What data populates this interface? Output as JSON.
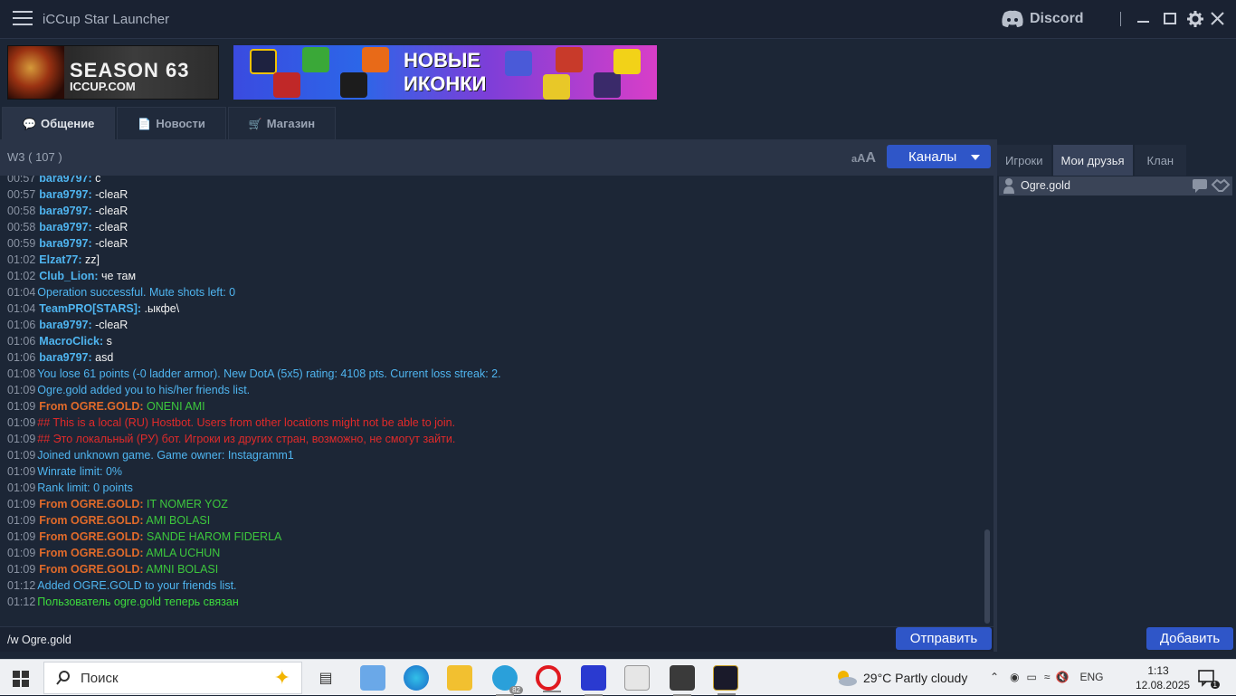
{
  "window": {
    "title": "iCCup Star Launcher",
    "discord_label": "Discord"
  },
  "banners": {
    "season_line1": "SEASON 63",
    "season_line2": "ICCUP.COM",
    "promo_line1": "НОВЫЕ",
    "promo_line2": "ИКОНКИ"
  },
  "tabs": [
    {
      "label": "Общение",
      "icon": "chat-icon",
      "active": true
    },
    {
      "label": "Новости",
      "icon": "news-icon",
      "active": false
    },
    {
      "label": "Магазин",
      "icon": "cart-icon",
      "active": false
    }
  ],
  "chat": {
    "channel": "W3",
    "user_count": "( 107 )",
    "font_size_label": "aAA",
    "channels_button": "Каналы",
    "input_value": "/w Ogre.gold",
    "send_button": "Отправить",
    "partial_top": {
      "time": "00:57",
      "nick": "bara9797:",
      "text": "c"
    },
    "lines": [
      {
        "time": "00:57",
        "type": "user",
        "nick": "bara9797:",
        "text": "-cleaR"
      },
      {
        "time": "00:58",
        "type": "user",
        "nick": "bara9797:",
        "text": "-cleaR"
      },
      {
        "time": "00:58",
        "type": "user",
        "nick": "bara9797:",
        "text": "-cleaR"
      },
      {
        "time": "00:59",
        "type": "user",
        "nick": "bara9797:",
        "text": "-cleaR"
      },
      {
        "time": "01:02",
        "type": "user",
        "nick": "Elzat77:",
        "text": "zz]"
      },
      {
        "time": "01:02",
        "type": "user",
        "nick": "Club_Lion:",
        "text": "че там"
      },
      {
        "time": "01:04",
        "type": "sys",
        "text": "Operation successful. Mute shots left: 0"
      },
      {
        "time": "01:04",
        "type": "user",
        "nick": "TeamPRO[STARS]:",
        "text": ".ыкфе\\"
      },
      {
        "time": "01:06",
        "type": "user",
        "nick": "bara9797:",
        "text": "-cleaR"
      },
      {
        "time": "01:06",
        "type": "user",
        "nick": "MacroClick:",
        "text": "s"
      },
      {
        "time": "01:06",
        "type": "user",
        "nick": "bara9797:",
        "text": "asd"
      },
      {
        "time": "01:08",
        "type": "sys",
        "text": "You lose 61 points (-0 ladder armor). New DotA (5x5) rating: 4108 pts. Current loss streak: 2."
      },
      {
        "time": "01:09",
        "type": "sys",
        "text": "Ogre.gold added you to his/her friends list."
      },
      {
        "time": "01:09",
        "type": "whisper",
        "nick": "From OGRE.GOLD:",
        "text": "ONENI AMI"
      },
      {
        "time": "01:09",
        "type": "warn",
        "text": "## This is a local (RU) Hostbot. Users from other locations might not be able to join."
      },
      {
        "time": "01:09",
        "type": "warn",
        "text": "## Это локальный (РУ) бот. Игроки из других стран, возможно, не смогут зайти."
      },
      {
        "time": "01:09",
        "type": "sys",
        "text": "Joined unknown game. Game owner: Instagramm1"
      },
      {
        "time": "01:09",
        "type": "sys",
        "text": "Winrate limit: 0%"
      },
      {
        "time": "01:09",
        "type": "sys",
        "text": "Rank limit: 0 points"
      },
      {
        "time": "01:09",
        "type": "whisper",
        "nick": "From OGRE.GOLD:",
        "text": "IT NOMER YOZ"
      },
      {
        "time": "01:09",
        "type": "whisper",
        "nick": "From OGRE.GOLD:",
        "text": "AMI BOLASI"
      },
      {
        "time": "01:09",
        "type": "whisper",
        "nick": "From OGRE.GOLD:",
        "text": "SANDE HAROM FIDERLA"
      },
      {
        "time": "01:09",
        "type": "whisper",
        "nick": "From OGRE.GOLD:",
        "text": "AMLA UCHUN"
      },
      {
        "time": "01:09",
        "type": "whisper",
        "nick": "From OGRE.GOLD:",
        "text": "AMNI BOLASI"
      },
      {
        "time": "01:12",
        "type": "sys",
        "text": "Added OGRE.GOLD to your friends list."
      },
      {
        "time": "01:12",
        "type": "success",
        "text": "Пользователь ogre.gold теперь связан"
      }
    ]
  },
  "right_panel": {
    "tabs": [
      {
        "label": "Игроки",
        "active": false
      },
      {
        "label": "Мои друзья",
        "active": true
      },
      {
        "label": "Клан",
        "active": false
      }
    ],
    "friends": [
      {
        "name": "Ogre.gold"
      }
    ],
    "add_button": "Добавить"
  },
  "taskbar": {
    "search_placeholder": "Поиск",
    "telegram_badge": "82",
    "weather": "29°C  Partly cloudy",
    "language": "ENG",
    "time": "1:13",
    "date": "12.08.2025",
    "notification_count": "1"
  },
  "colors": {
    "accent_button": "#2f56c8",
    "nick": "#4fb5f0",
    "whisper_nick": "#e06a2a",
    "whisper_text": "#3dc83d",
    "warning": "#e02a2a",
    "background": "#1c2636"
  }
}
